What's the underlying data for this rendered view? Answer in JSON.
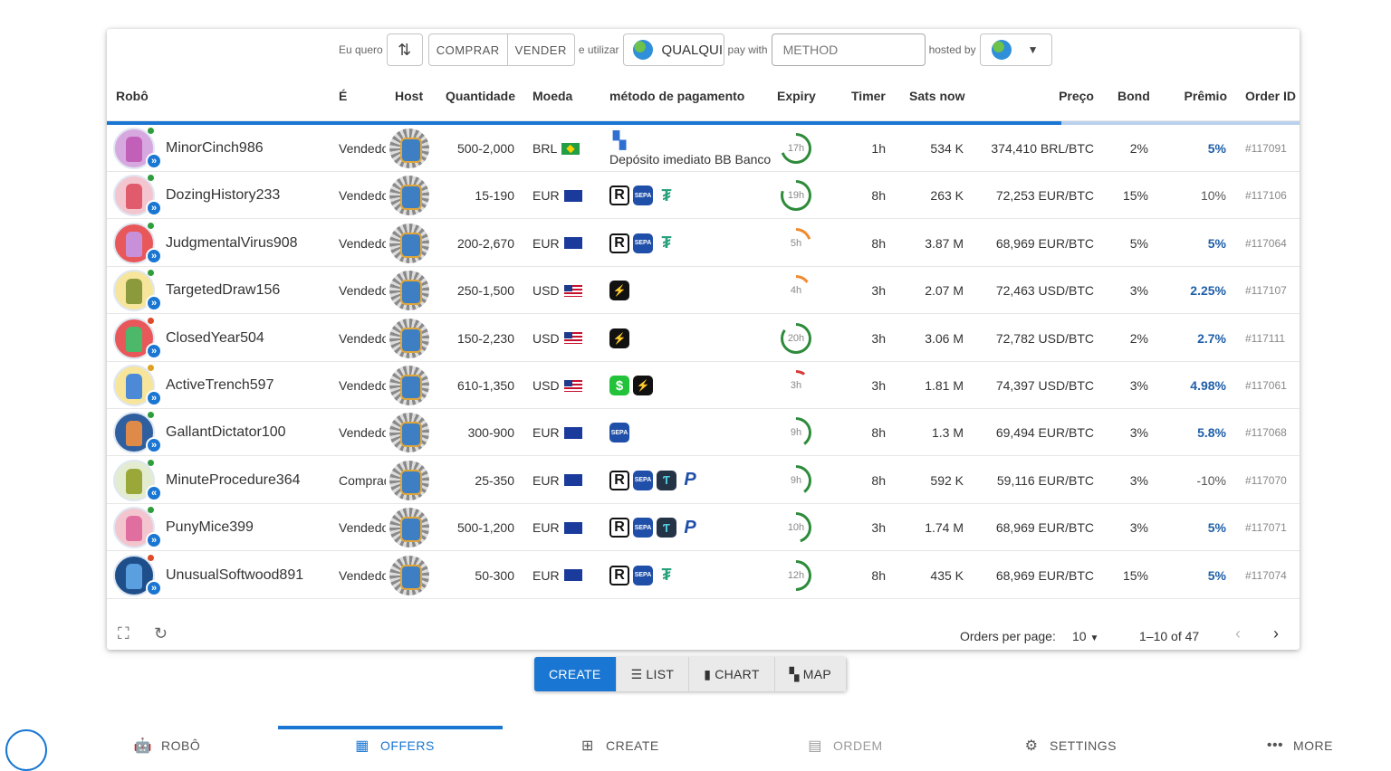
{
  "filters": {
    "want_label": "Eu quero",
    "buy_label": "COMPRAR",
    "sell_label": "VENDER",
    "use_label": "e utilizar",
    "currency_value": "QUALQUI",
    "pay_with_label": "pay with",
    "method_placeholder": "METHOD",
    "hosted_by_label": "hosted by"
  },
  "columns": {
    "robot": "Robô",
    "type": "É",
    "host": "Host",
    "amount": "Quantidade",
    "currency": "Moeda",
    "payment": "método de pagamento",
    "expiry": "Expiry",
    "timer": "Timer",
    "sats": "Sats now",
    "price": "Preço",
    "bond": "Bond",
    "premium": "Prêmio",
    "order_id": "Order ID"
  },
  "progress_fraction": 0.8,
  "rows": [
    {
      "name": "MinorCinch986",
      "type": "Vendedor",
      "amount": "500-2,000",
      "currency": "BRL",
      "flag": "brl",
      "methods": [
        "bb-icon"
      ],
      "method_text": "Depósito imediato BB Banco",
      "expiry": "17h",
      "expiry_frac": 0.7,
      "timer": "1h",
      "sats": "534 K",
      "price": "374,410 BRL/BTC",
      "bond": "2%",
      "premium": "5%",
      "premium_style": "pos",
      "order_id": "#117091",
      "avatar_color": "#d7a8e0",
      "bot_color": "#c25fb8",
      "dot": "#2e9d3c",
      "dir": "»"
    },
    {
      "name": "DozingHistory233",
      "type": "Vendedor",
      "amount": "15-190",
      "currency": "EUR",
      "flag": "eur",
      "methods": [
        "revolut-icon",
        "sepa-icon",
        "tether-icon"
      ],
      "method_text": "",
      "expiry": "19h",
      "expiry_frac": 0.8,
      "timer": "8h",
      "sats": "263 K",
      "price": "72,253 EUR/BTC",
      "bond": "15%",
      "premium": "10%",
      "premium_style": "neu",
      "order_id": "#117106",
      "avatar_color": "#f3c6cf",
      "bot_color": "#e05b6c",
      "dot": "#2e9d3c",
      "dir": "»"
    },
    {
      "name": "JudgmentalVirus908",
      "type": "Vendedor",
      "amount": "200-2,670",
      "currency": "EUR",
      "flag": "eur",
      "methods": [
        "revolut-icon",
        "sepa-icon",
        "tether-icon"
      ],
      "method_text": "",
      "expiry": "5h",
      "expiry_frac": 0.2,
      "timer": "8h",
      "sats": "3.87 M",
      "price": "68,969 EUR/BTC",
      "bond": "5%",
      "premium": "5%",
      "premium_style": "pos",
      "order_id": "#117064",
      "avatar_color": "#e8585a",
      "bot_color": "#c890d8",
      "dot": "#2e9d3c",
      "dir": "»"
    },
    {
      "name": "TargetedDraw156",
      "type": "Vendedor",
      "amount": "250-1,500",
      "currency": "USD",
      "flag": "usd",
      "methods": [
        "strike-icon"
      ],
      "method_text": "",
      "expiry": "4h",
      "expiry_frac": 0.15,
      "timer": "3h",
      "sats": "2.07 M",
      "price": "72,463 USD/BTC",
      "bond": "3%",
      "premium": "2.25%",
      "premium_style": "pos",
      "order_id": "#117107",
      "avatar_color": "#f6e59a",
      "bot_color": "#8a9a3c",
      "dot": "#2e9d3c",
      "dir": "»"
    },
    {
      "name": "ClosedYear504",
      "type": "Vendedor",
      "amount": "150-2,230",
      "currency": "USD",
      "flag": "usd",
      "methods": [
        "strike-icon"
      ],
      "method_text": "",
      "expiry": "20h",
      "expiry_frac": 0.85,
      "timer": "3h",
      "sats": "3.06 M",
      "price": "72,782 USD/BTC",
      "bond": "2%",
      "premium": "2.7%",
      "premium_style": "pos",
      "order_id": "#117111",
      "avatar_color": "#e8585a",
      "bot_color": "#4bb86a",
      "dot": "#e04a2a",
      "dir": "»"
    },
    {
      "name": "ActiveTrench597",
      "type": "Vendedor",
      "amount": "610-1,350",
      "currency": "USD",
      "flag": "usd",
      "methods": [
        "cash-app-icon",
        "strike-icon"
      ],
      "method_text": "",
      "expiry": "3h",
      "expiry_frac": 0.1,
      "timer": "3h",
      "sats": "1.81 M",
      "price": "74,397 USD/BTC",
      "bond": "3%",
      "premium": "4.98%",
      "premium_style": "pos",
      "order_id": "#117061",
      "avatar_color": "#f6e59a",
      "bot_color": "#4c8ad8",
      "dot": "#e0a020",
      "dir": "»"
    },
    {
      "name": "GallantDictator100",
      "type": "Vendedor",
      "amount": "300-900",
      "currency": "EUR",
      "flag": "eur",
      "methods": [
        "sepa-icon"
      ],
      "method_text": "",
      "expiry": "9h",
      "expiry_frac": 0.4,
      "timer": "8h",
      "sats": "1.3 M",
      "price": "69,494 EUR/BTC",
      "bond": "3%",
      "premium": "5.8%",
      "premium_style": "pos",
      "order_id": "#117068",
      "avatar_color": "#2f5f9e",
      "bot_color": "#e08a4a",
      "dot": "#2e9d3c",
      "dir": "»"
    },
    {
      "name": "MinuteProcedure364",
      "type": "Comprador",
      "amount": "25-350",
      "currency": "EUR",
      "flag": "eur",
      "methods": [
        "revolut-icon",
        "sepa-icon",
        "twint-icon",
        "paypal-icon"
      ],
      "method_text": "",
      "expiry": "9h",
      "expiry_frac": 0.4,
      "timer": "8h",
      "sats": "592 K",
      "price": "59,116 EUR/BTC",
      "bond": "3%",
      "premium": "-10%",
      "premium_style": "neu",
      "order_id": "#117070",
      "avatar_color": "#e4ecd0",
      "bot_color": "#9aa83a",
      "dot": "#2e9d3c",
      "dir": "«"
    },
    {
      "name": "PunyMice399",
      "type": "Vendedor",
      "amount": "500-1,200",
      "currency": "EUR",
      "flag": "eur",
      "methods": [
        "revolut-icon",
        "sepa-icon",
        "twint-icon",
        "paypal-icon"
      ],
      "method_text": "",
      "expiry": "10h",
      "expiry_frac": 0.45,
      "timer": "3h",
      "sats": "1.74 M",
      "price": "68,969 EUR/BTC",
      "bond": "3%",
      "premium": "5%",
      "premium_style": "pos",
      "order_id": "#117071",
      "avatar_color": "#f3c6cf",
      "bot_color": "#e06fa0",
      "dot": "#2e9d3c",
      "dir": "»"
    },
    {
      "name": "UnusualSoftwood891",
      "type": "Vendedor",
      "amount": "50-300",
      "currency": "EUR",
      "flag": "eur",
      "methods": [
        "revolut-icon",
        "sepa-icon",
        "tether-icon"
      ],
      "method_text": "",
      "expiry": "12h",
      "expiry_frac": 0.5,
      "timer": "8h",
      "sats": "435 K",
      "price": "68,969 EUR/BTC",
      "bond": "15%",
      "premium": "5%",
      "premium_style": "pos",
      "order_id": "#117074",
      "avatar_color": "#1f4f8a",
      "bot_color": "#5aa0e0",
      "dot": "#e04a2a",
      "dir": "»"
    }
  ],
  "footer": {
    "per_page_label": "Orders per page:",
    "per_page_value": "10",
    "range_text": "1–10 of 47"
  },
  "view_toggle": {
    "create": "CREATE",
    "list": "LIST",
    "chart": "CHART",
    "map": "MAP"
  },
  "bottom_nav": {
    "robot": "ROBÔ",
    "offers": "OFFERS",
    "create": "CREATE",
    "order": "ORDEM",
    "settings": "SETTINGS",
    "more": "MORE"
  },
  "colors": {
    "accent": "#1976d2",
    "premium_positive": "#1f5fa8"
  }
}
